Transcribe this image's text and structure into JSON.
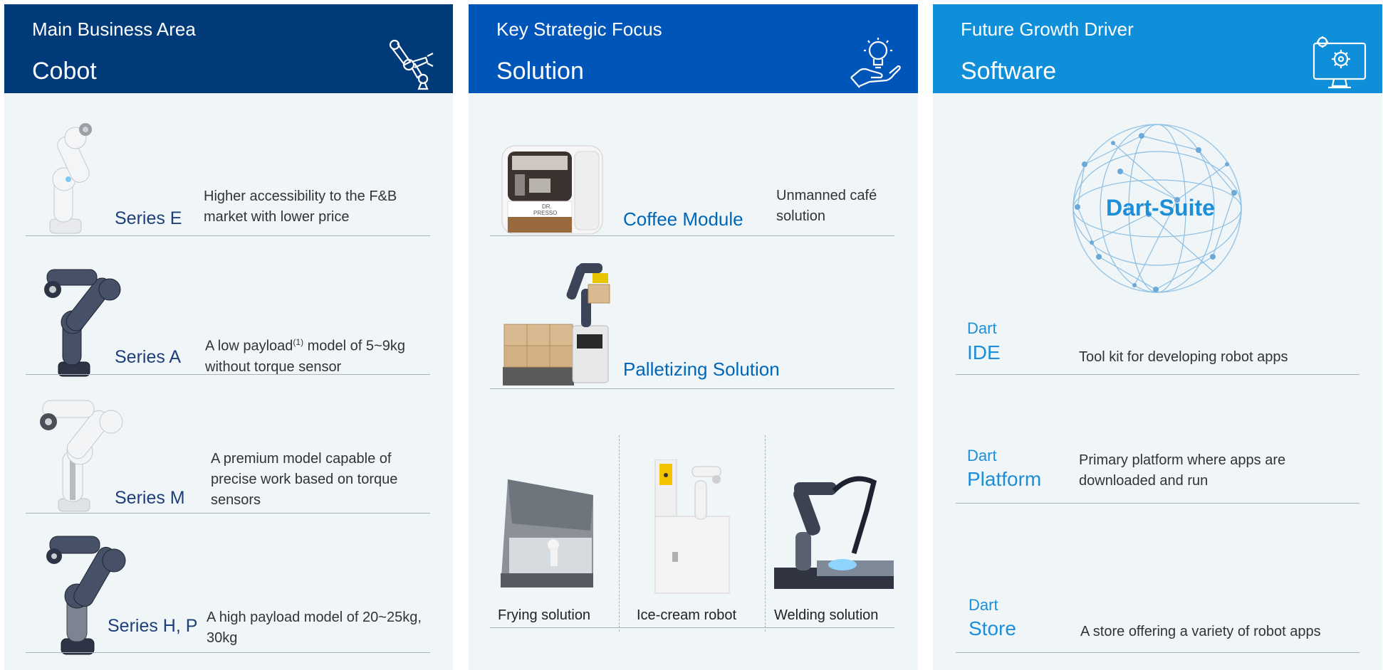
{
  "columns": [
    {
      "subtitle": "Main Business Area",
      "title": "Cobot",
      "icon": "robot-arm-icon",
      "header_color": "#003a78",
      "items": [
        {
          "name": "Series E",
          "desc_lines": [
            "Higher accessibility to the F&B",
            "market with lower price"
          ],
          "color": "white"
        },
        {
          "name": "Series A",
          "desc_pre": "A low payload",
          "desc_sup": "(1)",
          "desc_post": " model of 5~9kg",
          "desc_line2": "without torque sensor",
          "color": "navy"
        },
        {
          "name": "Series M",
          "desc_lines": [
            "A premium model capable of",
            "precise work based on torque",
            "sensors"
          ],
          "color": "white"
        },
        {
          "name": "Series H, P",
          "desc_lines": [
            "A high payload model of 20~25kg,",
            "30kg"
          ],
          "color": "navy"
        }
      ]
    },
    {
      "subtitle": "Key Strategic Focus",
      "title": "Solution",
      "icon": "lightbulb-hand-icon",
      "header_color": "#0055b8",
      "items": [
        {
          "name": "Coffee Module",
          "desc_lines": [
            "Unmanned café",
            "solution"
          ],
          "kiosk_text": [
            "DR.",
            "PRESSO"
          ]
        },
        {
          "name": "Palletizing Solution"
        }
      ],
      "tiles": [
        "Frying solution",
        "Ice-cream robot",
        "Welding solution"
      ]
    },
    {
      "subtitle": "Future Growth Driver",
      "title": "Software",
      "icon": "monitor-gears-icon",
      "header_color": "#0f8ed9",
      "globe_label": "Dart-Suite",
      "items": [
        {
          "small": "Dart",
          "big": "IDE",
          "desc_lines": [
            "Tool kit for developing robot apps"
          ]
        },
        {
          "small": "Dart",
          "big": "Platform",
          "desc_lines": [
            "Primary platform where apps are",
            "downloaded and run"
          ]
        },
        {
          "small": "Dart",
          "big": "Store",
          "desc_lines": [
            "A store offering a variety of robot apps"
          ]
        }
      ]
    }
  ]
}
